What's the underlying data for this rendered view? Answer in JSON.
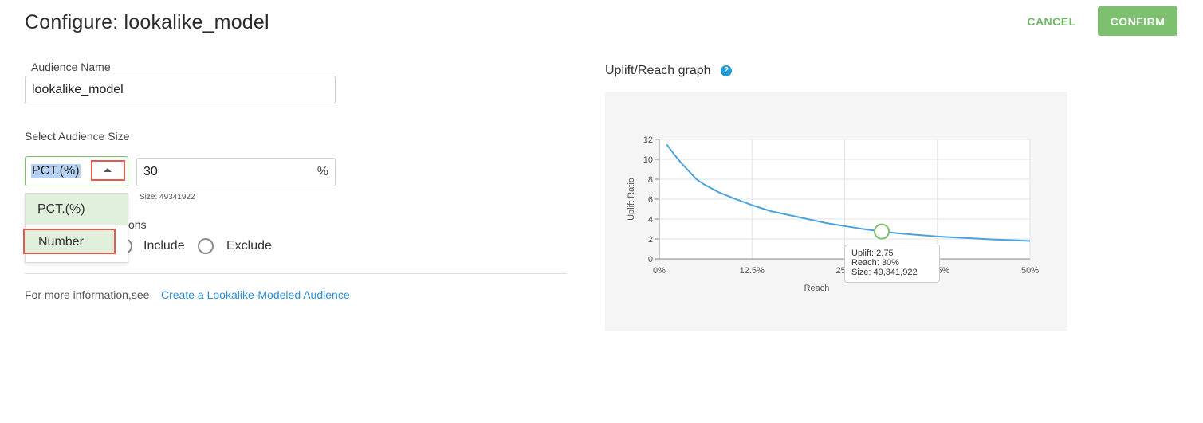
{
  "header": {
    "title": "Configure: lookalike_model",
    "cancel_label": "CANCEL",
    "confirm_label": "CONFIRM"
  },
  "form": {
    "audience_name_label": "Audience Name",
    "audience_name_value": "lookalike_model",
    "select_size_label": "Select Audience Size",
    "size_type_selected": "PCT.(%)",
    "size_value": "30",
    "size_unit": "%",
    "size_hint": "Size: 49341922",
    "dropdown_options": [
      "PCT.(%)",
      "Number"
    ],
    "criteria_label_partial": "ons",
    "radio_include": "Include",
    "radio_exclude": "Exclude",
    "info_prefix": "For more information,see",
    "info_link": "Create a Lookalike-Modeled Audience"
  },
  "graph": {
    "title": "Uplift/Reach graph",
    "help_icon": "?",
    "tooltip": {
      "uplift": "Uplift: 2.75",
      "reach": "Reach: 30%",
      "size": "Size: 49,341,922"
    }
  },
  "colors": {
    "accent_green": "#7cc070",
    "link_blue": "#2d8fd5",
    "highlight_red": "#e25c4d",
    "line_blue": "#4aa3df"
  },
  "chart_data": {
    "type": "line",
    "xlabel": "Reach",
    "ylabel": "Uplift Ratio",
    "x_ticks": [
      "0%",
      "12.5%",
      "25%",
      "37.5%",
      "50%"
    ],
    "y_ticks": [
      "0",
      "2",
      "4",
      "6",
      "8",
      "10",
      "12"
    ],
    "xlim": [
      0,
      50
    ],
    "ylim": [
      0,
      12
    ],
    "series": [
      {
        "x": [
          1,
          2,
          3,
          4,
          5,
          6,
          8,
          10,
          12.5,
          15,
          17.5,
          20,
          22.5,
          25,
          27.5,
          30,
          32.5,
          35,
          37.5,
          40,
          42.5,
          45,
          47.5,
          50
        ],
        "y": [
          11.5,
          10.5,
          9.6,
          8.8,
          8.0,
          7.5,
          6.7,
          6.1,
          5.4,
          4.8,
          4.4,
          4.0,
          3.6,
          3.3,
          3.0,
          2.75,
          2.55,
          2.4,
          2.25,
          2.15,
          2.05,
          1.95,
          1.88,
          1.8
        ]
      }
    ],
    "highlight_point": {
      "x": 30,
      "y": 2.75
    }
  }
}
